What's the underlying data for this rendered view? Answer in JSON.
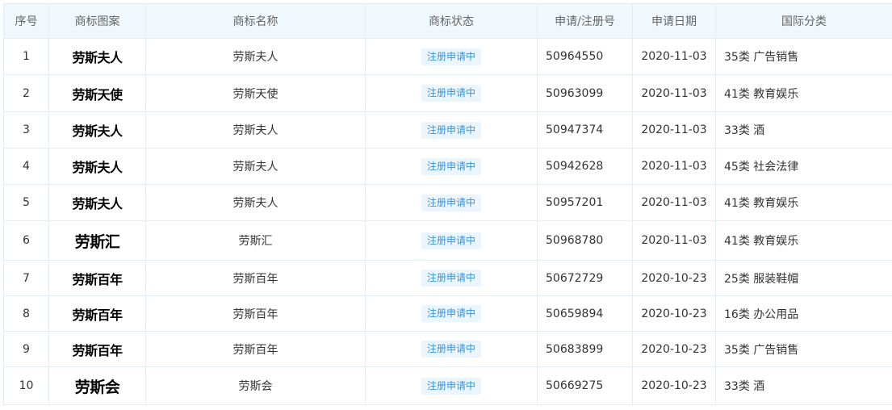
{
  "table": {
    "headers": {
      "num": "序号",
      "logo": "商标图案",
      "name": "商标名称",
      "status": "商标状态",
      "reg_no": "申请/注册号",
      "date": "申请日期",
      "class": "国际分类"
    },
    "rows": [
      {
        "num": "1",
        "logo": "劳斯夫人",
        "name": "劳斯夫人",
        "status": "注册申请中",
        "reg_no": "50964550",
        "date": "2020-11-03",
        "class": "35类 广告销售"
      },
      {
        "num": "2",
        "logo": "劳斯天使",
        "name": "劳斯天使",
        "status": "注册申请中",
        "reg_no": "50963099",
        "date": "2020-11-03",
        "class": "41类 教育娱乐"
      },
      {
        "num": "3",
        "logo": "劳斯夫人",
        "name": "劳斯夫人",
        "status": "注册申请中",
        "reg_no": "50947374",
        "date": "2020-11-03",
        "class": "33类 酒"
      },
      {
        "num": "4",
        "logo": "劳斯夫人",
        "name": "劳斯夫人",
        "status": "注册申请中",
        "reg_no": "50942628",
        "date": "2020-11-03",
        "class": "45类 社会法律"
      },
      {
        "num": "5",
        "logo": "劳斯夫人",
        "name": "劳斯夫人",
        "status": "注册申请中",
        "reg_no": "50957201",
        "date": "2020-11-03",
        "class": "41类 教育娱乐"
      },
      {
        "num": "6",
        "logo": "劳斯汇",
        "name": "劳斯汇",
        "status": "注册申请中",
        "reg_no": "50968780",
        "date": "2020-11-03",
        "class": "41类 教育娱乐"
      },
      {
        "num": "7",
        "logo": "劳斯百年",
        "name": "劳斯百年",
        "status": "注册申请中",
        "reg_no": "50672729",
        "date": "2020-10-23",
        "class": "25类 服装鞋帽"
      },
      {
        "num": "8",
        "logo": "劳斯百年",
        "name": "劳斯百年",
        "status": "注册申请中",
        "reg_no": "50659894",
        "date": "2020-10-23",
        "class": "16类 办公用品"
      },
      {
        "num": "9",
        "logo": "劳斯百年",
        "name": "劳斯百年",
        "status": "注册申请中",
        "reg_no": "50683899",
        "date": "2020-10-23",
        "class": "35类 广告销售"
      },
      {
        "num": "10",
        "logo": "劳斯会",
        "name": "劳斯会",
        "status": "注册申请中",
        "reg_no": "50669275",
        "date": "2020-10-23",
        "class": "33类 酒"
      }
    ]
  },
  "colors": {
    "header_bg": "#f1f8fd",
    "border": "#e4ecf3",
    "badge_bg": "#eaf5fd",
    "badge_text": "#3a93d8"
  }
}
